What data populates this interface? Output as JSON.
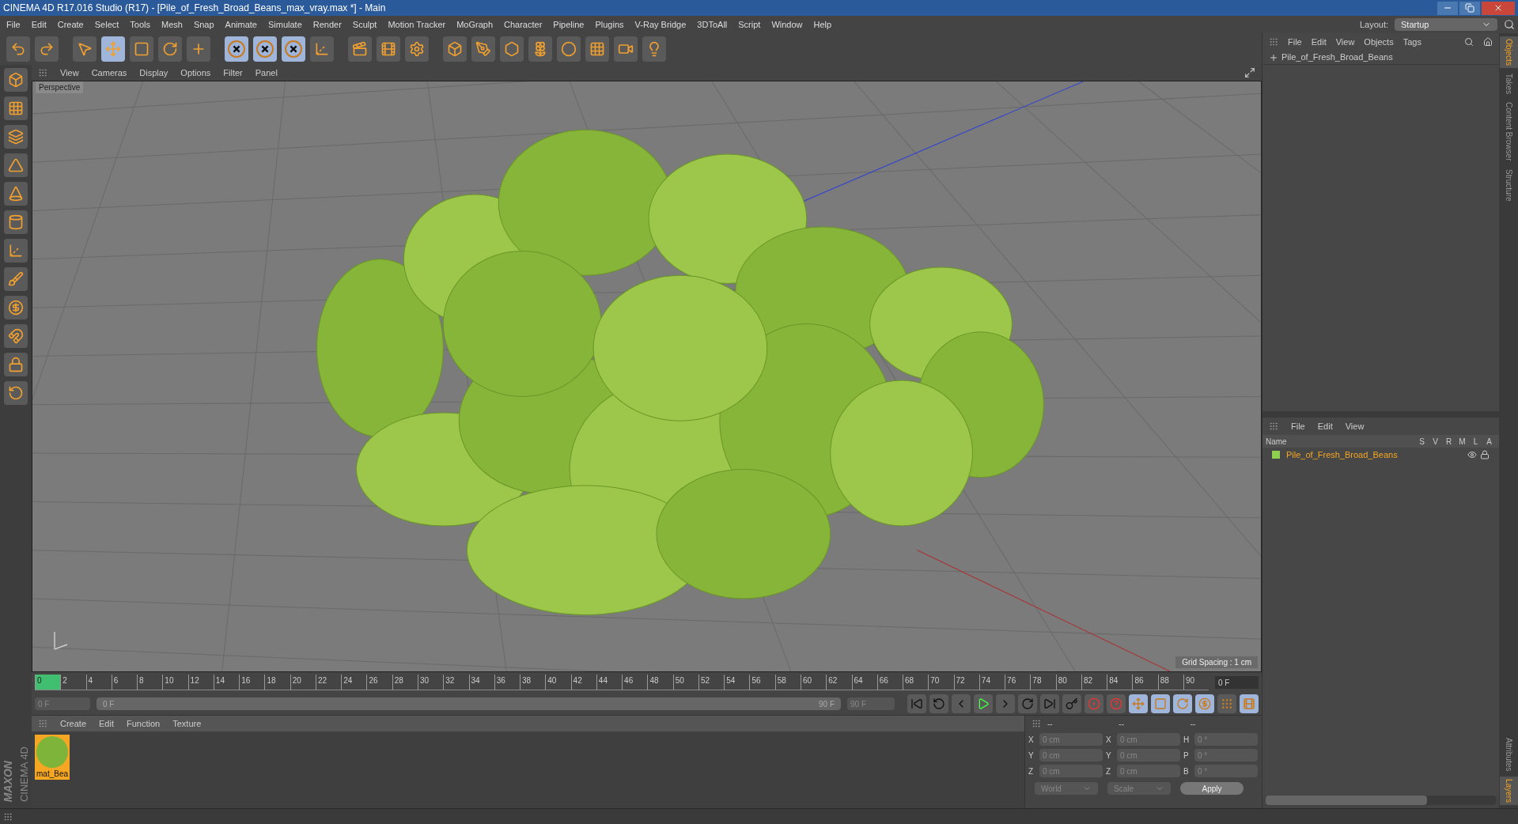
{
  "window": {
    "title": "CINEMA 4D R17.016 Studio (R17) - [Pile_of_Fresh_Broad_Beans_max_vray.max *] - Main"
  },
  "menu": [
    "File",
    "Edit",
    "Create",
    "Select",
    "Tools",
    "Mesh",
    "Snap",
    "Animate",
    "Simulate",
    "Render",
    "Sculpt",
    "Motion Tracker",
    "MoGraph",
    "Character",
    "Pipeline",
    "Plugins",
    "V-Ray Bridge",
    "3DToAll",
    "Script",
    "Window",
    "Help"
  ],
  "layout": {
    "label": "Layout:",
    "value": "Startup"
  },
  "toolbar": [
    {
      "active": false
    },
    {
      "active": false
    },
    {
      "active": false
    },
    {
      "active": true
    },
    {
      "active": false
    },
    {
      "active": false
    },
    {
      "active": false
    },
    {
      "active": true
    },
    {
      "active": true
    },
    {
      "active": true
    },
    {
      "active": false
    },
    {
      "active": false
    },
    {
      "active": false
    },
    {
      "active": false
    },
    {
      "active": false
    },
    {
      "active": false
    },
    {
      "active": false
    },
    {
      "active": false
    },
    {
      "active": false
    },
    {
      "active": false
    },
    {
      "active": false
    },
    {
      "active": false
    }
  ],
  "viewport": {
    "menu": [
      "View",
      "Cameras",
      "Display",
      "Options",
      "Filter",
      "Panel"
    ],
    "label": "Perspective",
    "grid_spacing": "Grid Spacing : 1 cm"
  },
  "timeline": {
    "ticks": [
      "0",
      "2",
      "4",
      "6",
      "8",
      "10",
      "12",
      "14",
      "16",
      "18",
      "20",
      "22",
      "24",
      "26",
      "28",
      "30",
      "32",
      "34",
      "36",
      "38",
      "40",
      "42",
      "44",
      "46",
      "48",
      "50",
      "52",
      "54",
      "56",
      "58",
      "60",
      "62",
      "64",
      "66",
      "68",
      "70",
      "72",
      "74",
      "76",
      "78",
      "80",
      "82",
      "84",
      "86",
      "88",
      "90"
    ],
    "current": "0 F",
    "start": "0 F",
    "range_start": "0 F",
    "range_end": "90 F",
    "range_slider": {
      "level": 1
    },
    "end": "90 F"
  },
  "materials": {
    "menu": [
      "Create",
      "Edit",
      "Function",
      "Texture"
    ],
    "items": [
      {
        "name": "mat_Bea",
        "selected": true
      }
    ]
  },
  "coordinates": {
    "headers": [
      "--",
      "--",
      "--"
    ],
    "rows": [
      {
        "axis": "X",
        "position": "0 cm",
        "size_axis": "X",
        "size": "0 cm",
        "rot_axis": "H",
        "rotation": "0 °"
      },
      {
        "axis": "Y",
        "position": "0 cm",
        "size_axis": "Y",
        "size": "0 cm",
        "rot_axis": "P",
        "rotation": "0 °"
      },
      {
        "axis": "Z",
        "position": "0 cm",
        "size_axis": "Z",
        "size": "0 cm",
        "rot_axis": "B",
        "rotation": "0 °"
      }
    ],
    "dropdowns": [
      "World",
      "Scale"
    ],
    "apply": "Apply"
  },
  "objects": {
    "menu": [
      "File",
      "Edit",
      "View",
      "Objects",
      "Tags"
    ],
    "items": [
      {
        "name": "Pile_of_Fresh_Broad_Beans"
      }
    ]
  },
  "layers": {
    "menu": [
      "File",
      "Edit",
      "View"
    ],
    "columns": [
      "Name",
      "S",
      "V",
      "R",
      "M",
      "L",
      "A"
    ],
    "items": [
      {
        "name": "Pile_of_Fresh_Broad_Beans",
        "color": "#8fd14f"
      }
    ]
  },
  "side_tabs_top": [
    {
      "label": "Objects",
      "selected": true
    },
    {
      "label": "Takes",
      "selected": false
    },
    {
      "label": "Content Browser",
      "selected": false
    },
    {
      "label": "Structure",
      "selected": false
    }
  ],
  "side_tabs_bottom": [
    {
      "label": "Attributes",
      "selected": false
    },
    {
      "label": "Layers",
      "selected": true
    }
  ],
  "logo": {
    "brand": "MAXON",
    "product": "CINEMA 4D"
  }
}
